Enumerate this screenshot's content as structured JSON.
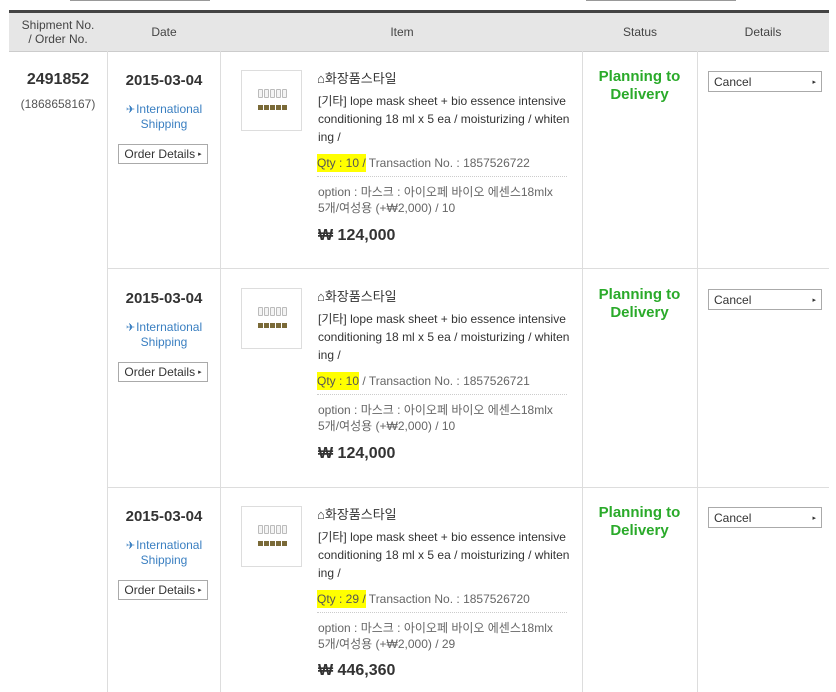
{
  "header": {
    "col_shipment": "Shipment No.",
    "col_order": "/ Order No.",
    "col_date": "Date",
    "col_item": "Item",
    "col_status": "Status",
    "col_details": "Details"
  },
  "shipment": {
    "number": "2491852",
    "order_no": "(1868658167)"
  },
  "rows": [
    {
      "date": "2015-03-04",
      "shipping_type": [
        "International",
        "Shipping"
      ],
      "order_details_label": "Order Details",
      "store": "화장품스타일",
      "item_name": "[기타] lope mask sheet + bio essence intensive conditioning 18 ml x 5 ea / moisturizing / whitening /",
      "qty": "Qty : 10 /",
      "transaction": " Transaction No. : 1857526722",
      "option_line1": "option : 마스크 : 아이오페 바이오 에센스18mlx",
      "option_line2": "5개/여성용 (+₩2,000) / 10",
      "price": "₩ 124,000",
      "status": [
        "Planning to",
        "Delivery"
      ],
      "cancel_label": "Cancel"
    },
    {
      "date": "2015-03-04",
      "shipping_type": [
        "International",
        "Shipping"
      ],
      "order_details_label": "Order Details",
      "store": "화장품스타일",
      "item_name": "[기타] lope mask sheet + bio essence intensive conditioning 18 ml x 5 ea / moisturizing / whitening /",
      "qty": "Qty : 10",
      "transaction": " / Transaction No. : 1857526721",
      "option_line1": "option : 마스크 : 아이오페 바이오 에센스18mlx",
      "option_line2": "5개/여성용 (+₩2,000) / 10",
      "price": "₩ 124,000",
      "status": [
        "Planning to",
        "Delivery"
      ],
      "cancel_label": "Cancel"
    },
    {
      "date": "2015-03-04",
      "shipping_type": [
        "International",
        "Shipping"
      ],
      "order_details_label": "Order Details",
      "store": "화장품스타일",
      "item_name": "[기타] lope mask sheet + bio essence intensive conditioning 18 ml x 5 ea / moisturizing / whitening /",
      "qty": "Qty : 29 /",
      "transaction": " Transaction No. : 1857526720",
      "option_line1": "option : 마스크 : 아이오페 바이오 에센스18mlx",
      "option_line2": "5개/여성용 (+₩2,000) / 29",
      "price": "₩ 446,360",
      "status": [
        "Planning to",
        "Delivery"
      ],
      "cancel_label": "Cancel"
    }
  ]
}
